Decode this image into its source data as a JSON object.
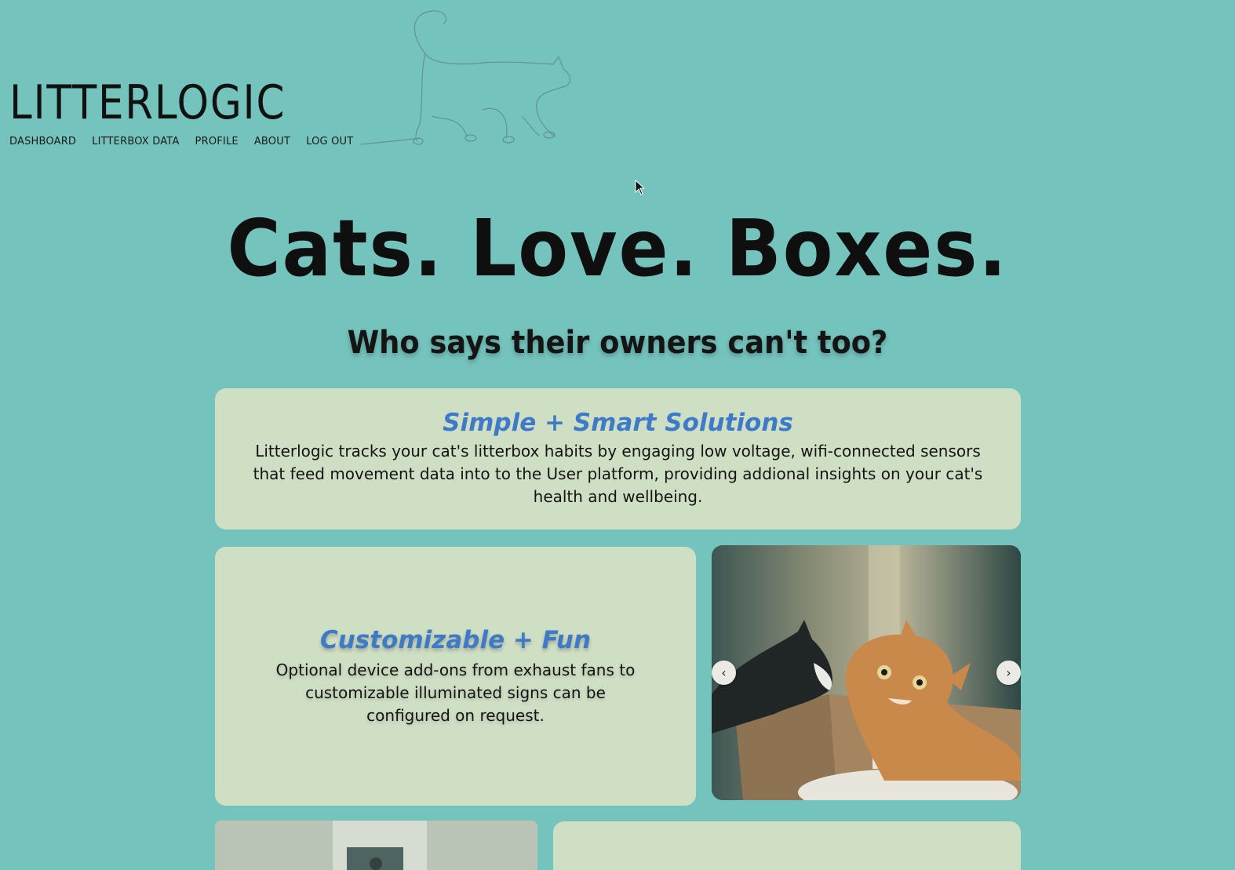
{
  "brand": {
    "title": "LITTERLOGIC"
  },
  "nav": {
    "items": [
      "DASHBOARD",
      "LITTERBOX DATA",
      "PROFILE",
      "ABOUT",
      "LOG OUT"
    ]
  },
  "hero": {
    "title": "Cats. Love. Boxes.",
    "subtitle": "Who says their owners can't too?"
  },
  "cards": [
    {
      "heading": "Simple + Smart Solutions",
      "body": "Litterlogic tracks your cat's litterbox habits by engaging low voltage, wifi-connected sensors that feed movement data into to the User platform, providing addional insights on your cat's health and wellbeing."
    },
    {
      "heading": "Customizable + Fun",
      "body": "Optional device add-ons from exhaust fans to customizable illuminated signs can be configured on request."
    }
  ],
  "carousel": {
    "prev_icon": "‹",
    "next_icon": "›"
  },
  "colors": {
    "background": "#75c3bd",
    "card": "#cfdfc4",
    "heading_accent": "#3f7ac9"
  },
  "icons": [
    "cat-outline-icon",
    "chevron-left-icon",
    "chevron-right-icon",
    "mouse-cursor-icon"
  ]
}
